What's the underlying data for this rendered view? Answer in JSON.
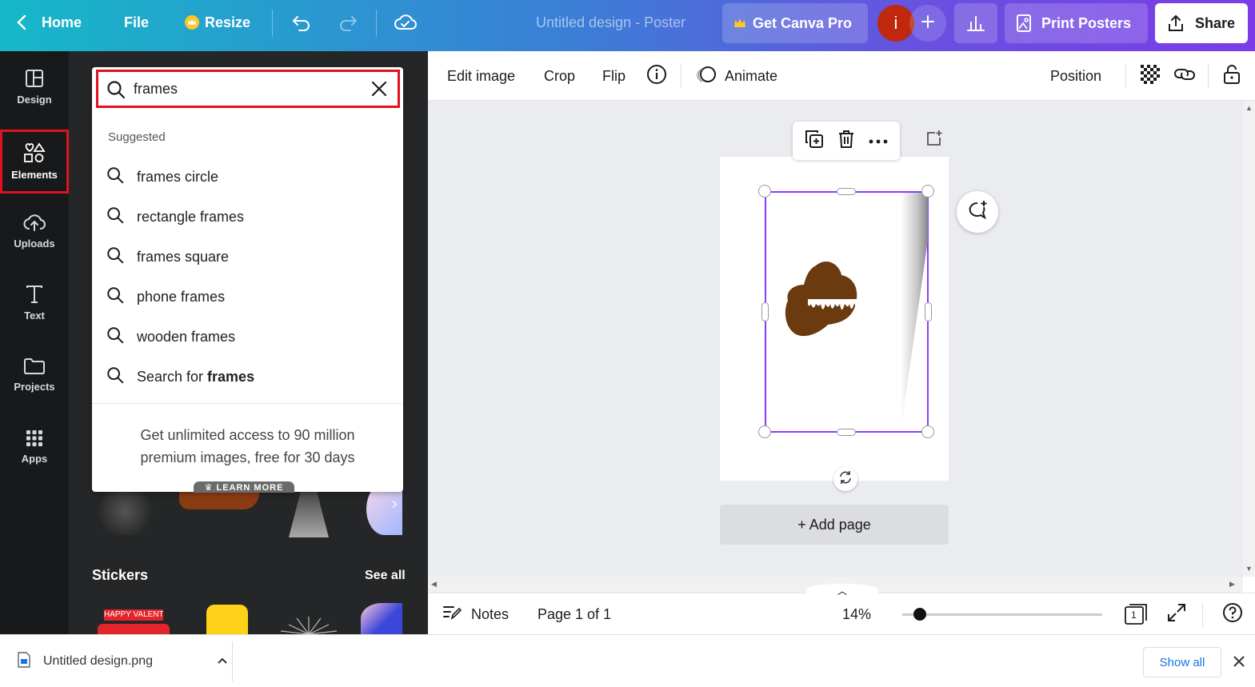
{
  "topbar": {
    "home": "Home",
    "file": "File",
    "resize": "Resize",
    "doc_title": "Untitled design - Poster",
    "get_pro": "Get Canva Pro",
    "avatar_initial": "i",
    "print": "Print Posters",
    "share": "Share",
    "gradient_start": "#16b8c8",
    "gradient_end": "#7c3ce8"
  },
  "rail": {
    "items": [
      {
        "label": "Design",
        "icon": "layout-icon"
      },
      {
        "label": "Elements",
        "icon": "shapes-icon"
      },
      {
        "label": "Uploads",
        "icon": "cloud-upload-icon"
      },
      {
        "label": "Text",
        "icon": "text-icon"
      },
      {
        "label": "Projects",
        "icon": "folder-icon"
      },
      {
        "label": "Apps",
        "icon": "grid-icon"
      }
    ],
    "active": "Elements"
  },
  "search": {
    "value": "frames",
    "suggested_heading": "Suggested",
    "suggestions": [
      "frames circle",
      "rectangle frames",
      "frames square",
      "phone frames",
      "wooden frames"
    ],
    "search_for_prefix": "Search for ",
    "search_for_term": "frames",
    "promo_line1": "Get unlimited access to 90 million",
    "promo_line2": "premium images, free for 30 days",
    "learn_more": "LEARN MORE"
  },
  "panel": {
    "stickers": "Stickers",
    "see_all": "See all",
    "sticker_text": "HAPPY VALENTINE'S"
  },
  "toolbar": {
    "edit_image": "Edit image",
    "crop": "Crop",
    "flip": "Flip",
    "animate": "Animate",
    "position": "Position"
  },
  "canvas": {
    "add_page": "+ Add page",
    "accent": "#8b3dff",
    "blob_color": "#6b3a0e"
  },
  "bottom": {
    "notes": "Notes",
    "page_info": "Page 1 of 1",
    "zoom": "14%",
    "zoom_fraction": 0.06,
    "page_count": "1"
  },
  "downloads": {
    "file": "Untitled design.png",
    "show_all": "Show all"
  }
}
